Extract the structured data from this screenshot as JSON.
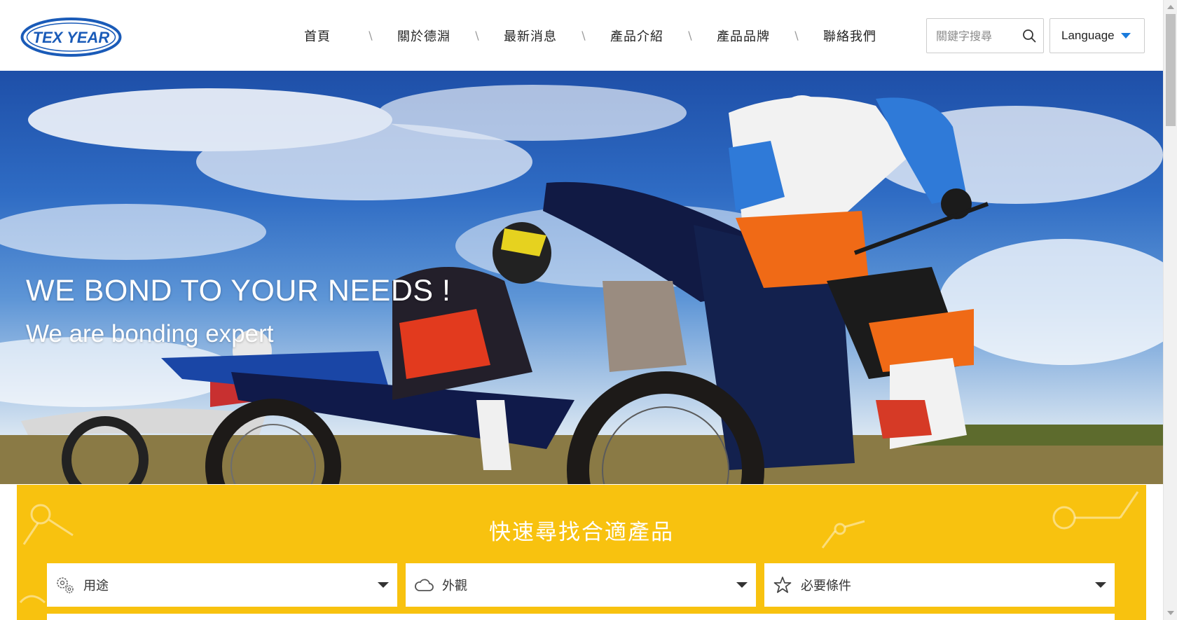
{
  "brand": {
    "logo_text": "TEX YEAR",
    "color_blue": "#1a5bb8",
    "color_yellow": "#f8c20f"
  },
  "nav": {
    "items": [
      {
        "label": "首頁"
      },
      {
        "label": "關於德淵"
      },
      {
        "label": "最新消息"
      },
      {
        "label": "產品介紹"
      },
      {
        "label": "產品品牌"
      },
      {
        "label": "聯絡我們"
      }
    ],
    "separator": "\\"
  },
  "search": {
    "placeholder": "關鍵字搜尋",
    "value": "",
    "icon": "search-icon"
  },
  "language": {
    "label": "Language",
    "icon": "caret-down-icon"
  },
  "hero": {
    "title": "WE BOND TO YOUR NEEDS !",
    "subtitle": "We are bonding expert"
  },
  "finder": {
    "title": "快速尋找合適產品",
    "selects": [
      {
        "label": "用途",
        "icon": "gears-icon"
      },
      {
        "label": "外觀",
        "icon": "cloud-icon"
      },
      {
        "label": "必要條件",
        "icon": "star-icon"
      }
    ]
  }
}
